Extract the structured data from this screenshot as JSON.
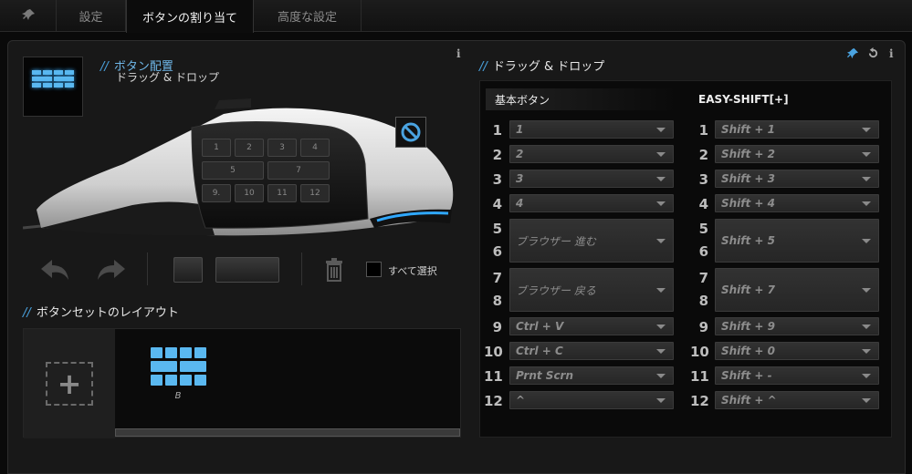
{
  "tabs": {
    "settings": "設定",
    "assignment": "ボタンの割り当て",
    "advanced": "高度な設定"
  },
  "left": {
    "title_slashes": "//",
    "title": "ボタン配置",
    "subtitle": "ドラッグ & ドロップ",
    "select_all": "すべて選択",
    "layout_title": "ボタンセットのレイアウト",
    "set_name": "B",
    "mouse_keys": [
      "1",
      "2",
      "3",
      "4",
      "5",
      "7",
      "9.",
      "10",
      "11",
      "12"
    ]
  },
  "right": {
    "title": "ドラッグ & ドロップ",
    "base_header": "基本ボタン",
    "shift_header": "EASY-SHIFT[+]",
    "rows": [
      {
        "num": "1",
        "base": "1",
        "shift": "Shift + 1"
      },
      {
        "num": "2",
        "base": "2",
        "shift": "Shift + 2"
      },
      {
        "num": "3",
        "base": "3",
        "shift": "Shift + 3"
      },
      {
        "num": "4",
        "base": "4",
        "shift": "Shift + 4"
      },
      {
        "num": "5",
        "num2": "6",
        "base": "ブラウザー 進む",
        "shift": "Shift + 5"
      },
      {
        "num": "7",
        "num2": "8",
        "base": "ブラウザー 戻る",
        "shift": "Shift + 7"
      },
      {
        "num": "9",
        "base": "Ctrl + V",
        "shift": "Shift + 9"
      },
      {
        "num": "10",
        "base": "Ctrl + C",
        "shift": "Shift + 0"
      },
      {
        "num": "11",
        "base": "Prnt Scrn",
        "shift": "Shift + -"
      },
      {
        "num": "12",
        "base": "^",
        "shift": "Shift + ^"
      }
    ]
  },
  "colors": {
    "accent": "#4aa3e0",
    "glow": "#5ab8f0",
    "background": "#181818"
  },
  "icons": [
    "pin-icon",
    "info-icon",
    "undo-icon",
    "redo-icon",
    "trash-icon",
    "plus-icon",
    "no-entry-icon",
    "reset-icon"
  ]
}
